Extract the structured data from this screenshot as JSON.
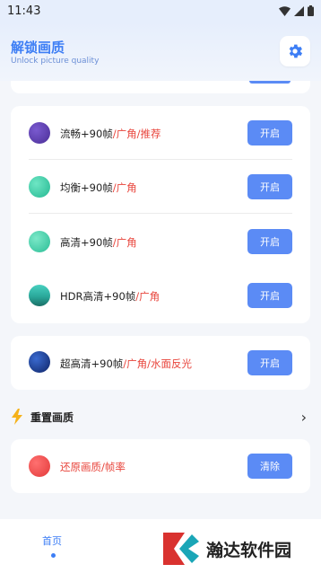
{
  "status_bar": {
    "time": "11:43"
  },
  "header": {
    "title": "解锁画质",
    "subtitle": "Unlock picture quality"
  },
  "colors": {
    "accent": "#3d7ef5",
    "button": "#5b8bf5",
    "highlight_text": "#e8453c"
  },
  "quality_options": [
    {
      "label": "流畅+90帧",
      "tag": "/广角/推荐",
      "button": "开启",
      "dot_color": "#5a3eb0"
    },
    {
      "label": "均衡+90帧",
      "tag": "/广角",
      "button": "开启",
      "dot_color": "#35c9a2"
    },
    {
      "label": "高清+90帧",
      "tag": "/广角",
      "button": "开启",
      "dot_color": "#3cc8a3"
    },
    {
      "label": "HDR高清+90帧",
      "tag": "/广角",
      "button": "开启",
      "dot_color": "#2ca89a"
    }
  ],
  "ultra_option": {
    "label": "超高清+90帧",
    "tag": "/广角/水面反光",
    "button": "开启",
    "dot_color": "#1d3f8f"
  },
  "reset_section": {
    "title": "重置画质",
    "item": {
      "label": "还原画质/帧率",
      "button": "清除",
      "dot_color": "#ef4b4b"
    }
  },
  "bottom_nav": {
    "home_label": "首页"
  },
  "watermark": {
    "text": "瀚达软件园"
  }
}
